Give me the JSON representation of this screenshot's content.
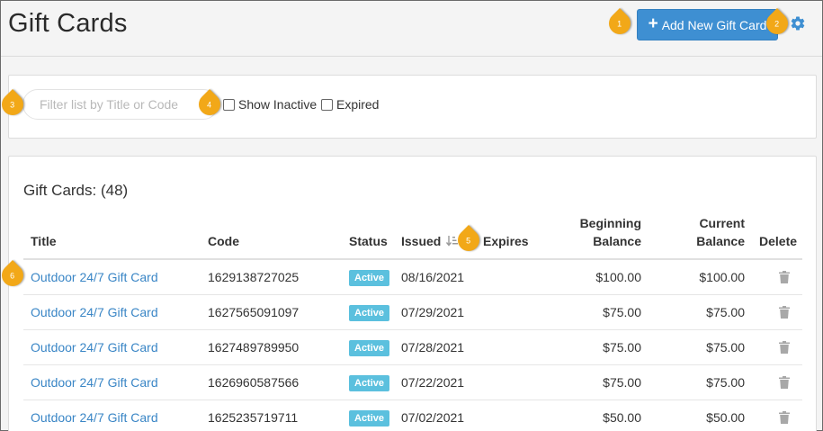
{
  "header": {
    "title": "Gift Cards",
    "add_button_label": "Add New Gift Card",
    "add_button_icon": "plus-icon",
    "settings_icon": "gear-icon"
  },
  "callouts": [
    "1",
    "2",
    "3",
    "4",
    "5",
    "6"
  ],
  "filters": {
    "search_placeholder": "Filter list by Title or Code",
    "search_value": "",
    "show_inactive_label": "Show Inactive",
    "show_inactive_checked": false,
    "expired_label": "Expired",
    "expired_checked": false
  },
  "list": {
    "heading": "Gift Cards: (48)",
    "columns": {
      "title": "Title",
      "code": "Code",
      "status": "Status",
      "issued": "Issued",
      "expires": "Expires",
      "beginning_balance_1": "Beginning",
      "beginning_balance_2": "Balance",
      "current_balance_1": "Current",
      "current_balance_2": "Balance",
      "delete": "Delete"
    },
    "sort_icon": "sort-descending-icon",
    "rows": [
      {
        "title": "Outdoor 24/7 Gift Card",
        "code": "1629138727025",
        "status": "Active",
        "issued": "08/16/2021",
        "expires": "",
        "beginning": "$100.00",
        "current": "$100.00"
      },
      {
        "title": "Outdoor 24/7 Gift Card",
        "code": "1627565091097",
        "status": "Active",
        "issued": "07/29/2021",
        "expires": "",
        "beginning": "$75.00",
        "current": "$75.00"
      },
      {
        "title": "Outdoor 24/7 Gift Card",
        "code": "1627489789950",
        "status": "Active",
        "issued": "07/28/2021",
        "expires": "",
        "beginning": "$75.00",
        "current": "$75.00"
      },
      {
        "title": "Outdoor 24/7 Gift Card",
        "code": "1626960587566",
        "status": "Active",
        "issued": "07/22/2021",
        "expires": "",
        "beginning": "$75.00",
        "current": "$75.00"
      },
      {
        "title": "Outdoor 24/7 Gift Card",
        "code": "1625235719711",
        "status": "Active",
        "issued": "07/02/2021",
        "expires": "",
        "beginning": "$50.00",
        "current": "$50.00"
      }
    ]
  },
  "colors": {
    "primary_button": "#3e8fd2",
    "link": "#3a86c6",
    "active_badge": "#5bc0de",
    "callout": "#f2a818"
  }
}
